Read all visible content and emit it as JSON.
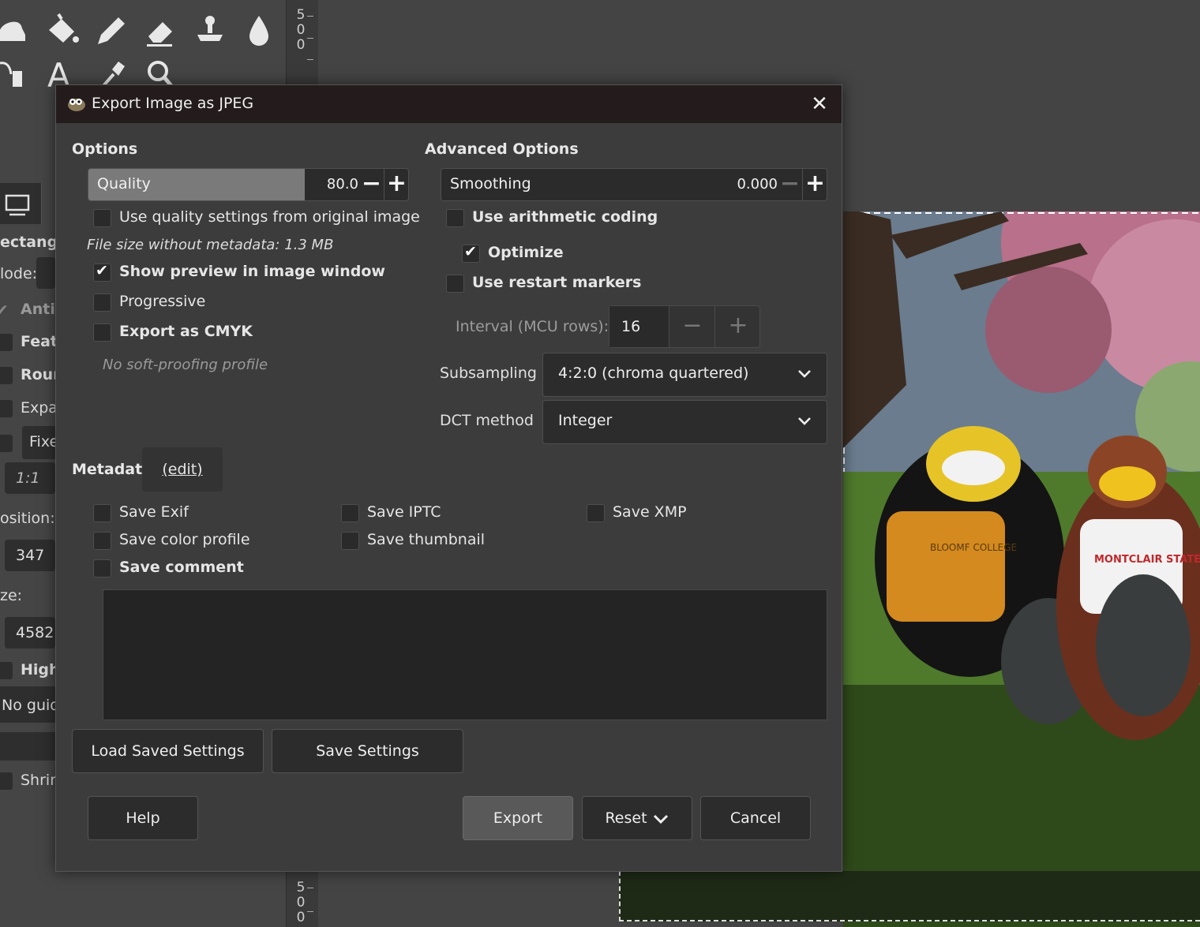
{
  "background": {
    "ruler_top_digits": [
      "5",
      "0",
      "0"
    ],
    "ruler_bottom_digits": [
      "5",
      "0",
      "0"
    ],
    "tool_options": {
      "shape_label": "ectangl",
      "mode_label": "lode:",
      "antialias_label": "Antia",
      "feather_label": "Feath",
      "round_label": "Rour",
      "expand_label": "Expa",
      "fixed_label": "Fixe",
      "ratio_value": "1:1",
      "position_label": "osition:",
      "position_value": "347",
      "size_label": "ze:",
      "size_value": "4582",
      "highlight_label": "High",
      "guides_value": "No guid",
      "shrink_label": "Shrin"
    },
    "photo_texts": {
      "left_jersey": "BLOOMF COLLEGE",
      "right_jersey": "MONTCLAIR STATE"
    }
  },
  "dialog": {
    "title": "Export Image as JPEG",
    "close_icon": "close-icon",
    "options": {
      "heading": "Options",
      "quality_label": "Quality",
      "quality_value": "80.0",
      "quality_fraction": 0.8,
      "use_original_quality": {
        "label": "Use quality settings from original image",
        "checked": false
      },
      "file_size_text": "File size without metadata: 1.3 MB",
      "show_preview": {
        "label": "Show preview in image window",
        "checked": true
      },
      "progressive": {
        "label": "Progressive",
        "checked": false
      },
      "export_cmyk": {
        "label": "Export as CMYK",
        "checked": false
      },
      "soft_proofing_text": "No soft-proofing profile"
    },
    "advanced": {
      "heading": "Advanced Options",
      "smoothing_label": "Smoothing",
      "smoothing_value": "0.000",
      "arithmetic_coding": {
        "label": "Use arithmetic coding",
        "checked": false
      },
      "optimize": {
        "label": "Optimize",
        "checked": true
      },
      "restart_markers": {
        "label": "Use restart markers",
        "checked": false
      },
      "interval_label": "Interval (MCU rows):",
      "interval_value": "16",
      "subsampling_label": "Subsampling",
      "subsampling_value": "4:2:0 (chroma quartered)",
      "dct_label": "DCT method",
      "dct_value": "Integer"
    },
    "metadata": {
      "heading": "Metadata",
      "edit_link": "(edit)",
      "save_exif": {
        "label": "Save Exif",
        "checked": false
      },
      "save_iptc": {
        "label": "Save IPTC",
        "checked": false
      },
      "save_xmp": {
        "label": "Save XMP",
        "checked": false
      },
      "save_color_profile": {
        "label": "Save color profile",
        "checked": false
      },
      "save_thumbnail": {
        "label": "Save thumbnail",
        "checked": false
      },
      "save_comment": {
        "label": "Save comment",
        "checked": false
      },
      "comment_text": ""
    },
    "buttons": {
      "load_saved": "Load Saved Settings",
      "save_settings": "Save Settings",
      "help": "Help",
      "export": "Export",
      "reset": "Reset",
      "cancel": "Cancel"
    }
  }
}
